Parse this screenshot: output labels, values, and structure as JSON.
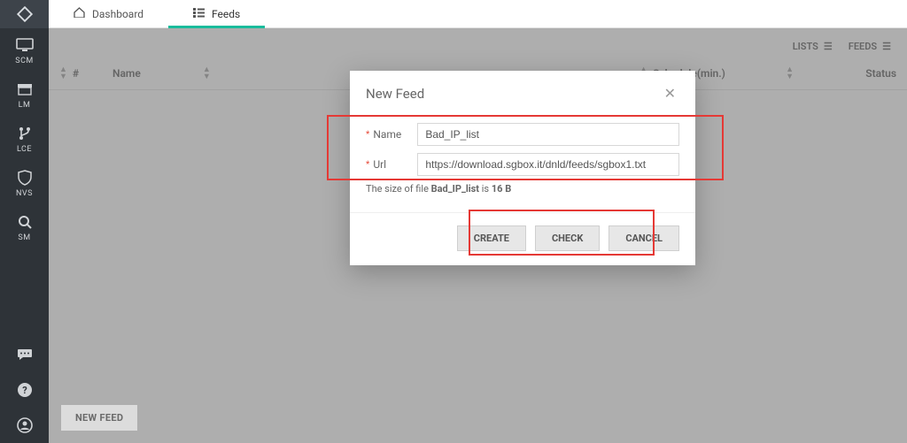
{
  "sidebar": {
    "items": [
      {
        "key": "scm",
        "label": "SCM"
      },
      {
        "key": "lm",
        "label": "LM"
      },
      {
        "key": "lce",
        "label": "LCE"
      },
      {
        "key": "nvs",
        "label": "NVS"
      },
      {
        "key": "sm",
        "label": "SM"
      }
    ]
  },
  "tabs": {
    "dashboard_label": "Dashboard",
    "feeds_label": "Feeds"
  },
  "actions": {
    "lists_label": "LISTS",
    "feeds_label": "FEEDS"
  },
  "table": {
    "hash_label": "#",
    "name_label": "Name",
    "schedule_label": "Schedule(min.)",
    "status_label": "Status"
  },
  "buttons": {
    "new_feed": "NEW FEED"
  },
  "modal": {
    "title": "New Feed",
    "name_label": "Name",
    "url_label": "Url",
    "name_value": "Bad_IP_list",
    "url_value": "https://download.sgbox.it/dnld/feeds/sgbox1.txt",
    "info_prefix": "The size of file ",
    "info_filename": "Bad_IP_list",
    "info_mid": " is ",
    "info_size": "16 B",
    "create_label": "CREATE",
    "check_label": "CHECK",
    "cancel_label": "CANCEL"
  }
}
